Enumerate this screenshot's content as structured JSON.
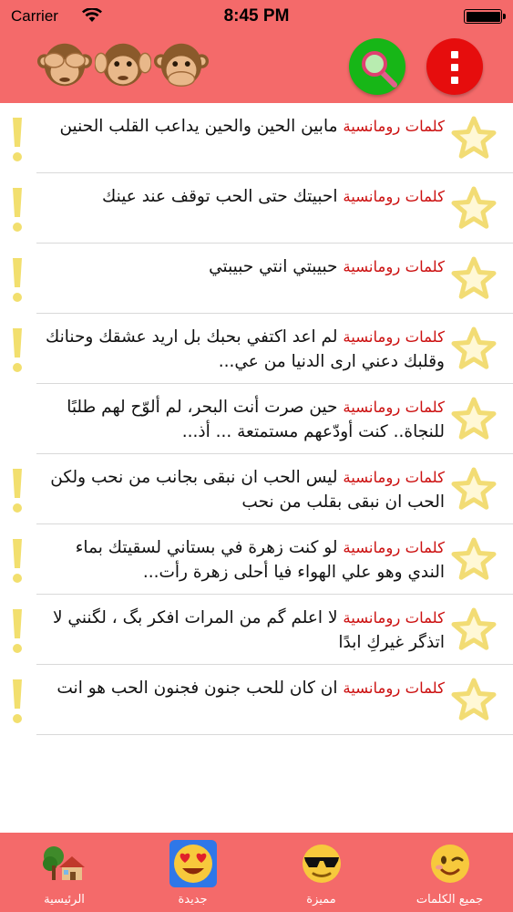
{
  "status_bar": {
    "carrier": "Carrier",
    "time": "8:45 PM",
    "battery_level": 1.0
  },
  "header": {
    "monkey_icons": [
      "see-no-evil-monkey-icon",
      "hear-no-evil-monkey-icon",
      "speak-no-evil-monkey-icon"
    ],
    "search_icon": "magnifier-icon",
    "menu_icon": "vertical-dots-icon"
  },
  "items": [
    {
      "category": "كلمات رومانسية",
      "text": "مابين الحين والحين يداعب القلب الحنين",
      "flag": true
    },
    {
      "category": "كلمات رومانسية",
      "text": "احبيتك حتى الحب توقف عند عينك",
      "flag": true
    },
    {
      "category": "كلمات رومانسية",
      "text": "حبيبتي انتي حبيبتي",
      "flag": true
    },
    {
      "category": "كلمات رومانسية",
      "text": "لم اعد اكتفي بحبك بل اريد عشقك وحنانك وقلبك دعني ارى الدنيا من عي...",
      "flag": true
    },
    {
      "category": "كلمات رومانسية",
      "text": "حين صرت أنت البحر، لم ألوّح لهم طلبًا للنجاة.. كنت أودّعهم مستمتعة ... أذ...",
      "flag": false
    },
    {
      "category": "كلمات رومانسية",
      "text": "ليس الحب ان نبقى بجانب من نحب ولكن الحب ان نبقى بقلب من نحب",
      "flag": true
    },
    {
      "category": "كلمات رومانسية",
      "text": "لو كنت زهرة في بستاني لسقيتك بماء الندي وهو علي الهواء فيا أحلى زهرة رأت...",
      "flag": true
    },
    {
      "category": "كلمات رومانسية",
      "text": "لا اعلم گم من المرات افكر بگ ، لگنني لا اتذگر غيركِ ابدًا",
      "flag": true
    },
    {
      "category": "كلمات رومانسية",
      "text": "ان كان للحب جنون فجنون الحب هو انت",
      "flag": true
    }
  ],
  "tabs": [
    {
      "label": "الرئيسية",
      "icon": "house-icon",
      "selected": false
    },
    {
      "label": "جديدة",
      "icon": "heart-eyes-icon",
      "selected": true
    },
    {
      "label": "مميزة",
      "icon": "sunglasses-icon",
      "selected": false
    },
    {
      "label": "جميع الكلمات",
      "icon": "winking-face-icon",
      "selected": false
    }
  ],
  "colors": {
    "header_bg": "#f46a6a",
    "category_text": "#cc1111",
    "star": "#f2dc74",
    "exclamation": "#f2df6e",
    "search_button": "#17b617",
    "menu_button": "#e60d0d",
    "tab_selected": "#2f77e8"
  }
}
